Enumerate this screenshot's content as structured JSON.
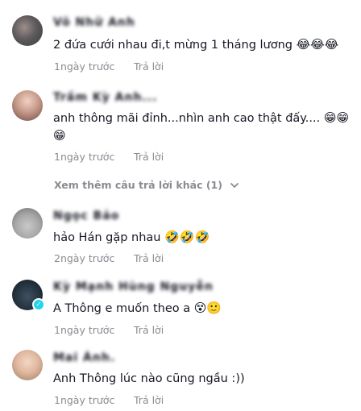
{
  "comments": [
    {
      "username": "Võ Nhữ Anh",
      "text": "2 đứa cưới nhau đi,t mừng 1 tháng lương",
      "emojis": "😂😂😂",
      "time": "1ngày trước",
      "reply_label": "Trả lời"
    },
    {
      "username": "Trầm Kỳ Anh...",
      "text": "anh thông mãi đỉnh...nhìn anh cao thật đấy....",
      "emojis": "😁😁",
      "emojis_line2": "😁",
      "time": "1ngày trước",
      "reply_label": "Trả lời"
    },
    {
      "username": "Ngọc Bảo",
      "text": "hảo Hán gặp nhau",
      "emojis": "🤣🤣🤣",
      "time": "2ngày trước",
      "reply_label": "Trả lời"
    },
    {
      "username": "Kỳ Mạnh Hùng Nguyễn",
      "text": "A Thông e muốn theo a",
      "emojis": "😵🙂",
      "time": "1ngày trước",
      "reply_label": "Trả lời"
    },
    {
      "username": "Mai Ánh.",
      "text": "Anh Thông lúc nào cũng ngầu :))",
      "emojis": "",
      "time": "1ngày trước",
      "reply_label": "Trả lời"
    }
  ],
  "view_more_replies": "Xem thêm câu trả lời khác (1)",
  "icons": {
    "chevron": "chevron-down-icon",
    "verified": "verified-badge-icon"
  },
  "colors": {
    "text": "#161823",
    "muted": "#8a8b91",
    "verified": "#20d5ec"
  }
}
